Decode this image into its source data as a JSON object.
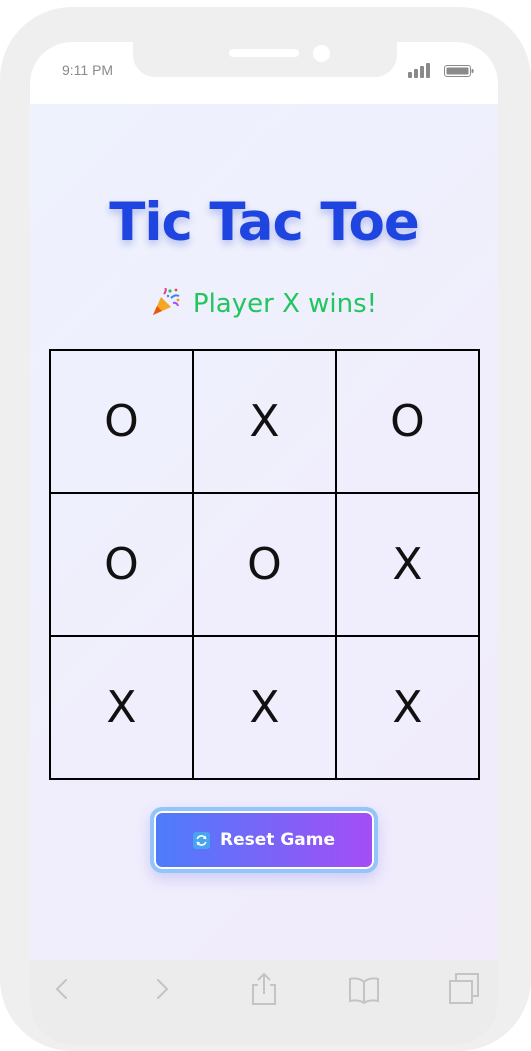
{
  "status_bar": {
    "time": "9:11 PM",
    "icons": [
      "signal-icon",
      "battery-icon"
    ]
  },
  "game": {
    "title": "Tic Tac Toe",
    "status_text": "Player X wins!",
    "status_icon": "party-popper-icon",
    "status_color": "#22c55e",
    "title_color": "#1f45e0",
    "board": [
      [
        "O",
        "X",
        "O"
      ],
      [
        "O",
        "O",
        "X"
      ],
      [
        "X",
        "X",
        "X"
      ]
    ],
    "reset_label": "Reset Game",
    "reset_icon": "refresh-icon"
  },
  "toolbar": {
    "icons": [
      "back-icon",
      "forward-icon",
      "share-icon",
      "bookmarks-icon",
      "tabs-icon"
    ]
  }
}
